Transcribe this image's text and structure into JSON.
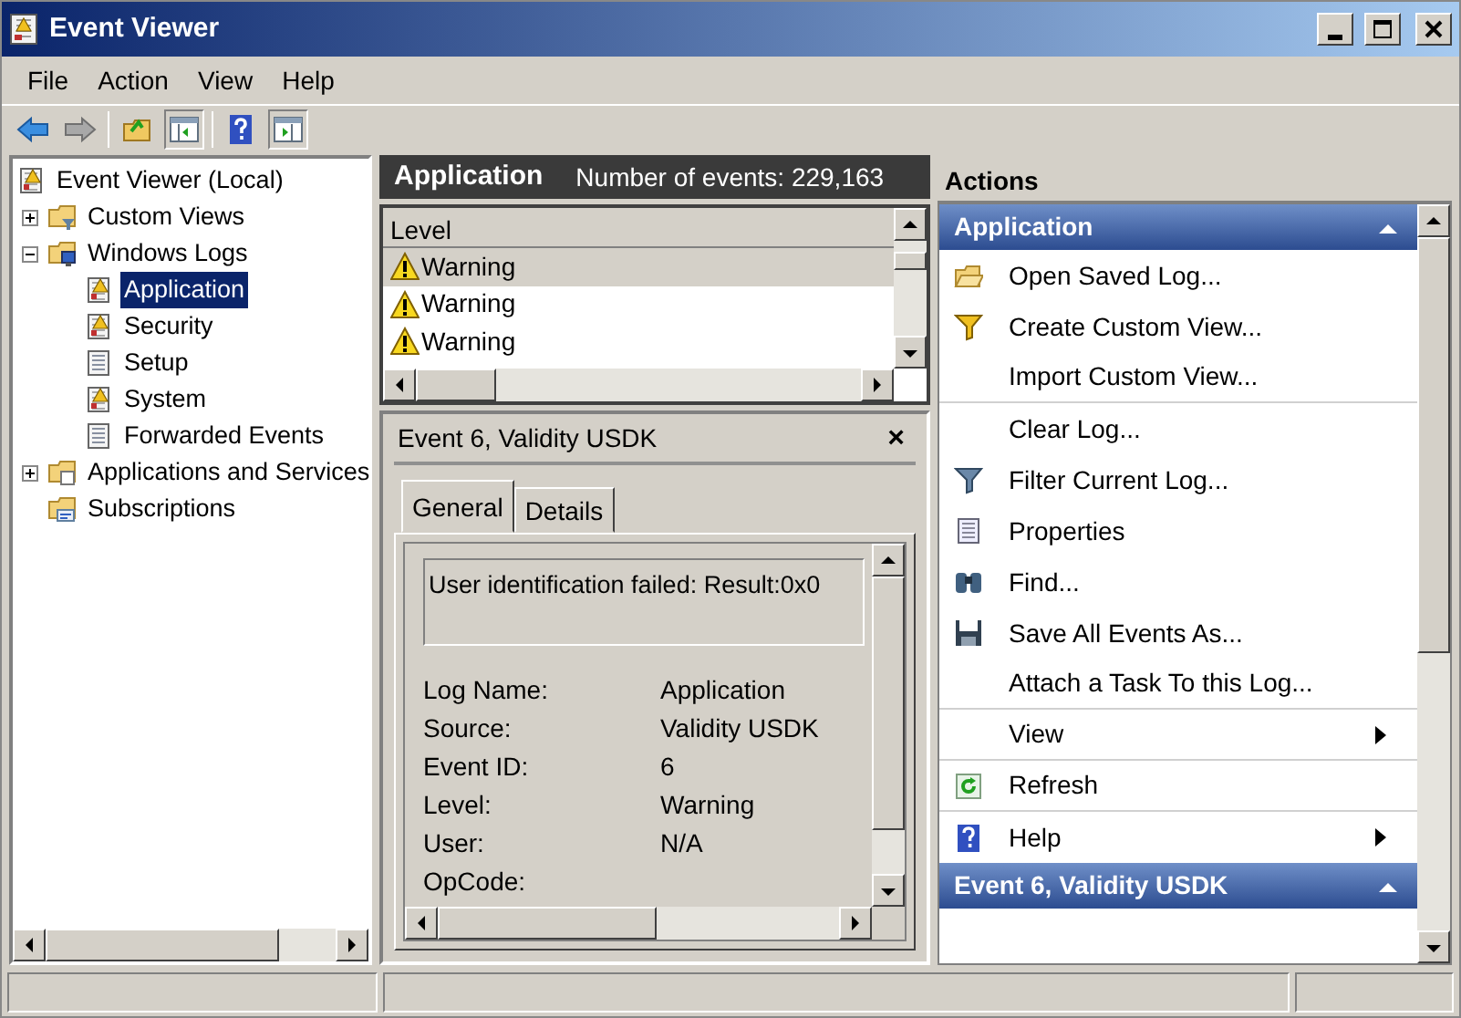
{
  "window": {
    "title": "Event Viewer"
  },
  "menu": [
    "File",
    "Action",
    "View",
    "Help"
  ],
  "tree": [
    {
      "label": "Event Viewer (Local)",
      "kind": "log-warn",
      "selected": false,
      "children": [
        {
          "label": "Custom Views",
          "kind": "folder-filter",
          "expanded": false,
          "selected": false
        },
        {
          "label": "Windows Logs",
          "kind": "folder-pc",
          "expanded": true,
          "selected": false,
          "children": [
            {
              "label": "Application",
              "kind": "log-warn",
              "selected": true
            },
            {
              "label": "Security",
              "kind": "log-warn",
              "selected": false
            },
            {
              "label": "Setup",
              "kind": "log",
              "selected": false
            },
            {
              "label": "System",
              "kind": "log-warn",
              "selected": false
            },
            {
              "label": "Forwarded Events",
              "kind": "log",
              "selected": false
            }
          ]
        },
        {
          "label": "Applications and Services",
          "kind": "folder-doc",
          "expanded": false,
          "selected": false
        },
        {
          "label": "Subscriptions",
          "kind": "folder-sub",
          "selected": false
        }
      ]
    }
  ],
  "log_header": {
    "title": "Application",
    "count": "Number of events: 229,163"
  },
  "events": {
    "columns": [
      "Level"
    ],
    "rows": [
      {
        "level": "Warning",
        "selected": true
      },
      {
        "level": "Warning",
        "selected": false
      },
      {
        "level": "Warning",
        "selected": false
      }
    ]
  },
  "event_details": {
    "title": "Event 6, Validity USDK",
    "close": "×",
    "tabs": [
      {
        "label": "General",
        "selected": true
      },
      {
        "label": "Details",
        "selected": false
      }
    ],
    "description": "User identification failed: Result:0x0",
    "fields": [
      {
        "label": "Log Name:",
        "value": "Application"
      },
      {
        "label": "Source:",
        "value": "Validity USDK"
      },
      {
        "label": "Event ID:",
        "value": "6"
      },
      {
        "label": "Level:",
        "value": "Warning"
      },
      {
        "label": "User:",
        "value": "N/A"
      },
      {
        "label": "OpCode:"
      }
    ]
  },
  "actions": {
    "title": "Actions",
    "sections": [
      {
        "title": "Application",
        "expanded": true,
        "items": [
          {
            "label": "Open Saved Log...",
            "kind": "folder",
            "submenu": false,
            "separator_after": false
          },
          {
            "label": "Create Custom View...",
            "kind": "filter-yellow",
            "submenu": false,
            "separator_after": false
          },
          {
            "label": "Import Custom View...",
            "kind": "plain",
            "submenu": false,
            "separator_after": true
          },
          {
            "label": "Clear Log...",
            "kind": "plain",
            "submenu": false,
            "separator_after": false
          },
          {
            "label": "Filter Current Log...",
            "kind": "filter",
            "submenu": false,
            "separator_after": false
          },
          {
            "label": "Properties",
            "kind": "properties",
            "submenu": false,
            "separator_after": false
          },
          {
            "label": "Find...",
            "kind": "binoculars",
            "submenu": false,
            "separator_after": false
          },
          {
            "label": "Save All Events As...",
            "kind": "disk",
            "submenu": false,
            "separator_after": false
          },
          {
            "label": "Attach a Task To this Log...",
            "kind": "plain",
            "submenu": false,
            "separator_after": true
          },
          {
            "label": "View",
            "kind": "plain",
            "submenu": true,
            "separator_after": true
          },
          {
            "label": "Refresh",
            "kind": "refresh",
            "submenu": false,
            "separator_after": true
          },
          {
            "label": "Help",
            "kind": "help",
            "submenu": true,
            "separator_after": false
          }
        ]
      },
      {
        "title": "Event 6, Validity USDK",
        "expanded": true
      }
    ]
  }
}
